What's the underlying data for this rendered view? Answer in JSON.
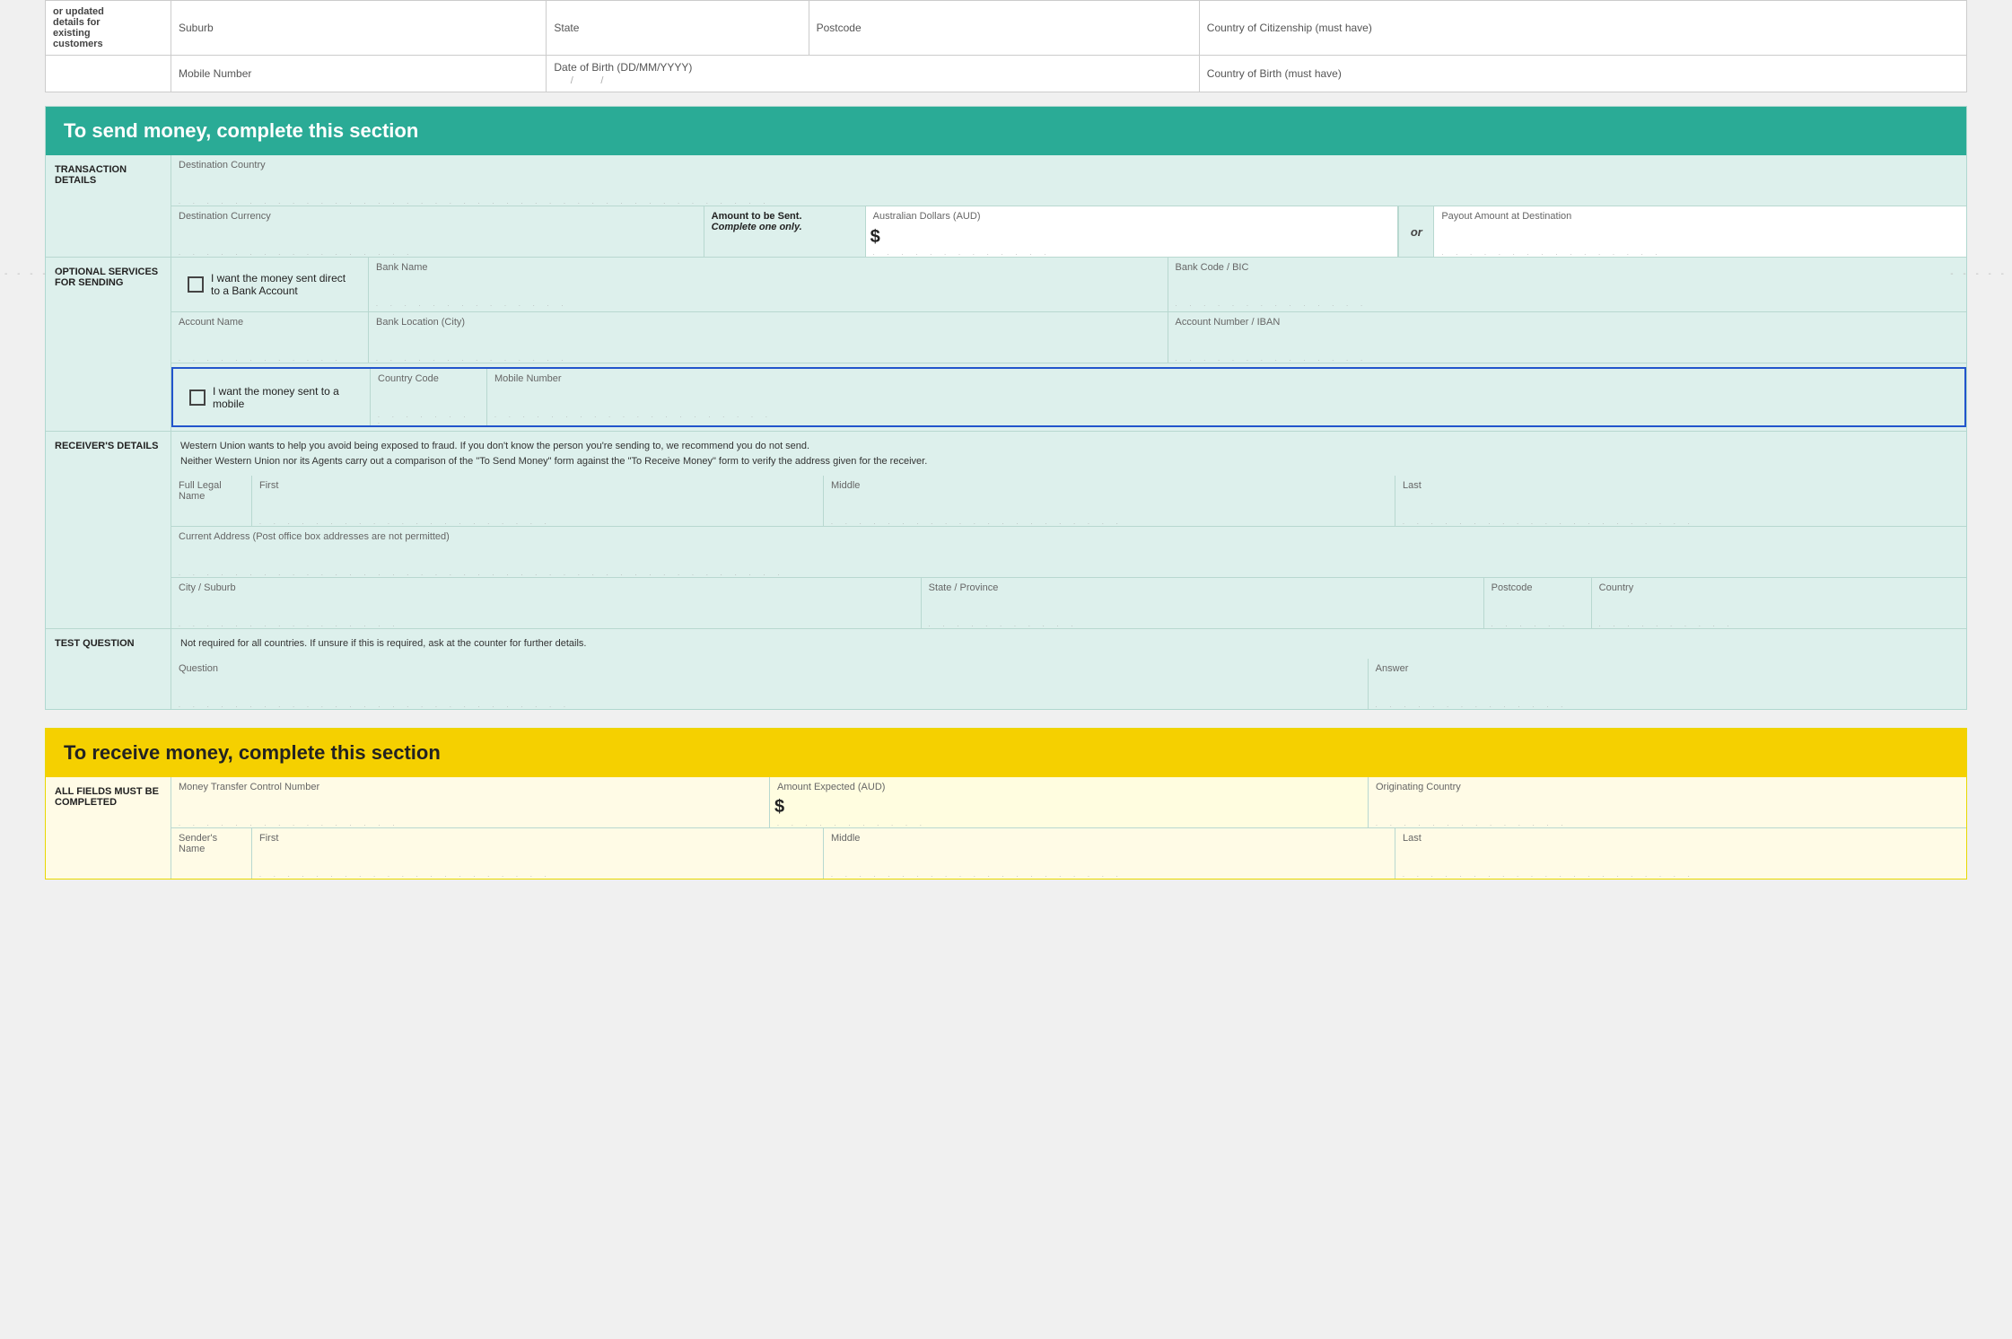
{
  "top_section": {
    "row1": {
      "suburb_label": "Suburb",
      "state_label": "State",
      "postcode_label": "Postcode",
      "country_citizenship_label": "Country of Citizenship (must have)"
    },
    "row2": {
      "mobile_label": "Mobile Number",
      "dob_label": "Date of Birth (DD/MM/YYYY)",
      "country_birth_label": "Country of Birth (must have)"
    }
  },
  "send_section": {
    "header": "To send money, complete this section",
    "transaction_details_label": "TRANSACTION DETAILS",
    "destination_country_label": "Destination Country",
    "destination_currency_label": "Destination Currency",
    "amount_to_be_sent_label": "Amount to be Sent.",
    "complete_one_only_label": "Complete one only.",
    "aud_label": "Australian Dollars (AUD)",
    "dollar_sign": "$",
    "or_label": "or",
    "payout_amount_label": "Payout Amount at Destination",
    "optional_services_label": "OPTIONAL SERVICES FOR SENDING",
    "bank_account_checkbox_label": "I want the money sent direct to a Bank Account",
    "bank_name_label": "Bank Name",
    "bank_code_label": "Bank Code / BIC",
    "account_name_label": "Account Name",
    "bank_location_label": "Bank Location (City)",
    "account_number_label": "Account Number / IBAN",
    "mobile_checkbox_label": "I want the money sent to a mobile",
    "country_code_label": "Country Code",
    "mobile_number_label": "Mobile Number",
    "receivers_details_label": "RECEIVER'S DETAILS",
    "fraud_warning": "Western Union wants to help you avoid being exposed to fraud. If you don't know the person you're sending to, we recommend you do not send.",
    "fraud_warning2": "Neither Western Union nor its Agents carry out a comparison of the \"To Send Money\" form against the \"To Receive Money\" form to verify the address given for the receiver.",
    "full_legal_name_label": "Full Legal Name",
    "first_label": "First",
    "middle_label": "Middle",
    "last_label": "Last",
    "current_address_label": "Current Address  (Post office box addresses are not permitted)",
    "city_suburb_label": "City / Suburb",
    "state_province_label": "State / Province",
    "postcode_label": "Postcode",
    "country_label": "Country",
    "test_question_label": "TEST QUESTION",
    "not_required_label": "Not required for all countries. If unsure if this is required, ask at the counter for further details.",
    "question_label": "Question",
    "answer_label": "Answer"
  },
  "receive_section": {
    "header": "To receive money, complete this section",
    "all_fields_label": "All fields must be completed",
    "money_transfer_label": "Money Transfer Control Number",
    "amount_expected_label": "Amount Expected (AUD)",
    "dollar_sign": "$",
    "originating_country_label": "Originating Country",
    "senders_name_label": "Sender's Name",
    "first_label": "First",
    "middle_label": "Middle",
    "last_label": "Last"
  },
  "dashes_left": "- - - - -",
  "dashes_right": "- - - - -"
}
